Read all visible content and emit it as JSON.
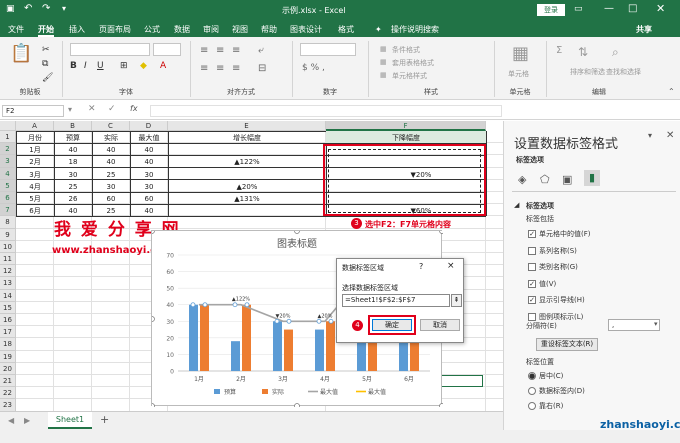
{
  "title": {
    "filename": "示例.xlsx - Excel",
    "login": "登录"
  },
  "menu": [
    "文件",
    "开始",
    "插入",
    "页面布局",
    "公式",
    "数据",
    "审阅",
    "视图",
    "帮助",
    "图表设计",
    "格式"
  ],
  "menu_search": "操作说明搜索",
  "menu_share": "共享",
  "ribbon": {
    "groups": [
      "剪贴板",
      "字体",
      "对齐方式",
      "数字",
      "样式",
      "单元格",
      "编辑"
    ],
    "font_name": "",
    "font_size": "",
    "style_items": [
      "条件格式",
      "套用表格格式",
      "单元格样式"
    ],
    "cells_label": "单元格",
    "edit_items": [
      "排序和筛选",
      "查找和选择"
    ]
  },
  "formula": {
    "namebox": "F2",
    "fx": "fx"
  },
  "columns": [
    "A",
    "B",
    "C",
    "D",
    "E",
    "F"
  ],
  "rows": [
    "1",
    "2",
    "3",
    "4",
    "5",
    "6",
    "7",
    "8",
    "9",
    "10",
    "11",
    "12",
    "13",
    "14",
    "15",
    "16",
    "17",
    "18",
    "19",
    "20",
    "21",
    "22",
    "23"
  ],
  "table": {
    "header": [
      "月份",
      "预算",
      "实际",
      "最大值",
      "增长幅度",
      "下降幅度"
    ],
    "rows": [
      [
        "1月",
        "40",
        "40",
        "40",
        "",
        ""
      ],
      [
        "2月",
        "18",
        "40",
        "40",
        "▲122%",
        ""
      ],
      [
        "3月",
        "30",
        "25",
        "30",
        "",
        "▼20%"
      ],
      [
        "4月",
        "25",
        "30",
        "30",
        "▲20%",
        ""
      ],
      [
        "5月",
        "26",
        "60",
        "60",
        "▲131%",
        ""
      ],
      [
        "6月",
        "40",
        "25",
        "40",
        "",
        "▼60%"
      ]
    ]
  },
  "watermark": {
    "cn": "我 爱 分 享 网",
    "url": "www.zhanshaoyi.com",
    "corner": "zhanshaoyi.com"
  },
  "annotation": {
    "step3": "3",
    "step3_text": "选中F2：F7单元格内容",
    "step4": "4"
  },
  "chart_data": {
    "type": "bar",
    "title": "图表标题",
    "categories": [
      "1月",
      "2月",
      "3月",
      "4月",
      "5月",
      "6月"
    ],
    "ylim": [
      0,
      70
    ],
    "yticks": [
      "0",
      "10",
      "20",
      "30",
      "40",
      "50",
      "60",
      "70"
    ],
    "series": [
      {
        "name": "预算",
        "type": "bar",
        "values": [
          40,
          18,
          30,
          25,
          26,
          40
        ],
        "color": "#5b9bd5"
      },
      {
        "name": "实际",
        "type": "bar",
        "values": [
          40,
          40,
          25,
          30,
          60,
          25
        ],
        "color": "#ed7d31"
      },
      {
        "name": "最大值",
        "type": "line",
        "values": [
          40,
          40,
          30,
          30,
          60,
          40
        ],
        "color": "#a5a5a5"
      },
      {
        "name": "最大值",
        "type": "line",
        "values": [
          40,
          40,
          30,
          30,
          60,
          40
        ],
        "color": "#ffc000"
      }
    ],
    "legend": [
      "预算",
      "实际",
      "最大值",
      "最大值"
    ],
    "data_labels": [
      "",
      "▲122%",
      "▼20%",
      "▲20%",
      "▲131%",
      "▼60%"
    ],
    "grid": true
  },
  "dialog": {
    "title": "数据标签区域",
    "help": "?",
    "close": "×",
    "label": "选择数据标签区域",
    "value": "=Sheet1!$F$2:$F$7",
    "ok": "确定",
    "cancel": "取消"
  },
  "pane": {
    "title": "设置数据标签格式",
    "subtitle": "标签选项",
    "section": "标签选项",
    "contains": "标签包括",
    "options": [
      {
        "label": "单元格中的值(F)",
        "checked": true
      },
      {
        "label": "系列名称(S)",
        "checked": false
      },
      {
        "label": "类别名称(G)",
        "checked": false
      },
      {
        "label": "值(V)",
        "checked": true
      },
      {
        "label": "显示引导线(H)",
        "checked": true
      },
      {
        "label": "图例项标示(L)",
        "checked": false
      }
    ],
    "separator_label": "分隔符(E)",
    "separator_value": ",",
    "reset_btn": "重设标签文本(R)",
    "position_label": "标签位置",
    "positions": [
      {
        "label": "居中(C)",
        "checked": true
      },
      {
        "label": "数据标签内(D)",
        "checked": false
      },
      {
        "label": "靠右(R)",
        "checked": false
      }
    ]
  },
  "sheet_tab": "Sheet1",
  "add_sheet": "+"
}
